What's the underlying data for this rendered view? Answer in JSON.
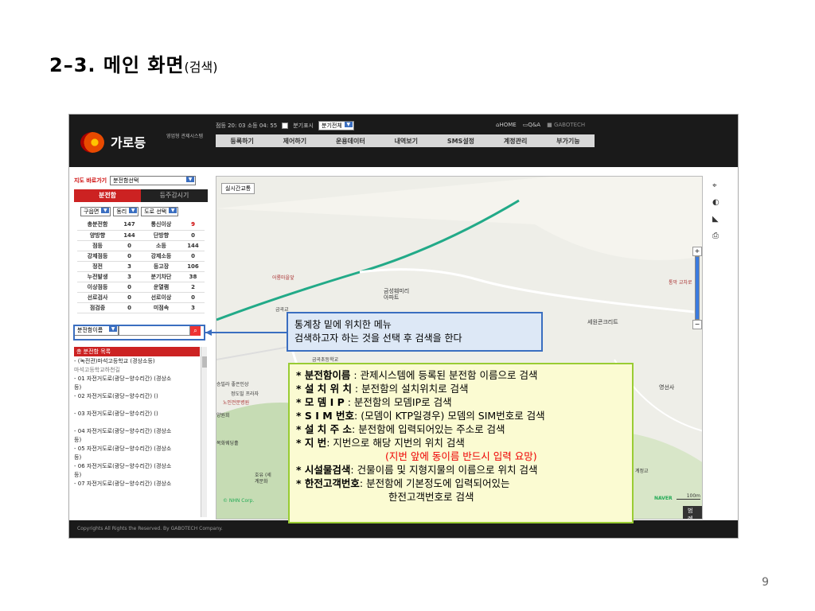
{
  "slide": {
    "title": "2–3. 메인 화면",
    "title_sub": "(검색)",
    "page_number": "9"
  },
  "app": {
    "logo_name": "가로등",
    "logo_tag": "영업형 관제시스템",
    "top_info": {
      "status_text": "점등 20: 03 소등 04: 55",
      "branch_label": "분기표시",
      "branch_select": "분기전체"
    },
    "top_links": {
      "home": "HOME",
      "qa": "Q&A",
      "company": "GABOTECH"
    },
    "nav": [
      "등록하기",
      "제어하기",
      "운용데이터",
      "내역보기",
      "SMS설정",
      "계정관리",
      "부가기능"
    ],
    "footer": "Copyrights All Rights the Reserved. By GABOTECH Company."
  },
  "left_panel": {
    "jump_label": "지도 바로가기",
    "jump_select": "분전함선택",
    "tabs": [
      "분전함",
      "등주감시기"
    ],
    "filters": [
      "구읍면",
      "동리",
      "도로 선택"
    ],
    "stats": [
      [
        "총분전함",
        "147",
        "통신이상",
        "9"
      ],
      [
        "양방향",
        "144",
        "단방향",
        "0"
      ],
      [
        "점등",
        "0",
        "소등",
        "144"
      ],
      [
        "강제점등",
        "0",
        "강제소등",
        "0"
      ],
      [
        "정전",
        "3",
        "등고장",
        "106"
      ],
      [
        "누전발생",
        "3",
        "분기차단",
        "38"
      ],
      [
        "이상점등",
        "0",
        "운열램",
        "2"
      ],
      [
        "선로검사",
        "0",
        "선로이상",
        "0"
      ],
      [
        "점검중",
        "0",
        "미점속",
        "3"
      ]
    ],
    "search_select": "분전함이름",
    "list_header": "총 분전함 목록",
    "list_items": [
      "- (녹전관)마석고등학교 (경상소등)",
      "마석고등학교하천길",
      "- 01 자전거도로(광당~양수리간) (경상소",
      "등)",
      "- 02 자전거도로(광당~양수리간) ()",
      "",
      "- 03 자전거도로(광당~양수리간) ()",
      "",
      "- 04 자전거도로(광당~양수리간) (경상소",
      "등)",
      "- 05 자전거도로(광당~양수리간) (경상소",
      "등)",
      "- 06 자전거도로(광당~양수리간) (경상소",
      "등)",
      "- 07 자전거도로(광당~양수리간) (경상소"
    ]
  },
  "map": {
    "realtime_btn": "실시간교통",
    "labels": {
      "seowon": "세원콘크리트",
      "yeongseonsa": "영선사",
      "eoryong": "어룡마을앞",
      "geumseong": "금성훼미리 아파트",
      "geumgok_school": "금곡초등학교",
      "geumgok_gyo": "금곡교",
      "tongmak": "통막 교차로",
      "gyejeong": "계정교",
      "jeongdo": "정도빌 프라자",
      "noinjeong": "노인전문병원",
      "yangwon": "양원회",
      "mokhwa": "목화웨딩홀",
      "hoyu": "호유 (세계문화",
      "sunggun": "승빌라 좋은인상"
    },
    "nhn": "© NHN Corp.",
    "naver": "NAVER",
    "scale": "100m",
    "legend": "범례"
  },
  "callout1": {
    "line1": "통계창 밑에 위치한 메뉴",
    "line2": "검색하고자 하는 것을 선택 후 검색을 한다"
  },
  "callout2": [
    {
      "key": "분전함이름",
      "sep": " : ",
      "text": "관제시스템에 등록된 분전함 이름으로 검색"
    },
    {
      "key": "설 치 위 치",
      "sep": " : ",
      "text": "분전함의 설치위치로 검색"
    },
    {
      "key": "모 뎀  I P",
      "sep": " : ",
      "text": "분전함의 모뎀IP로 검색"
    },
    {
      "key": "S I M 번호",
      "sep": ": ",
      "text": "(모뎀이 KTP일경우) 모뎀의 SIM번호로 검색"
    },
    {
      "key": "설 치 주 소",
      "sep": ": ",
      "text": "분전함에 입력되어있는 주소로 검색"
    },
    {
      "key": "지       번",
      "sep": ": ",
      "text": "지번으로 해당 지번의 위치 검색"
    },
    {
      "note": "(지번 앞에 동이름 반드시 입력 요망)"
    },
    {
      "key": "시설물검색",
      "sep": ": ",
      "text": "건물이름 및 지형지물의 이름으로 위치 검색"
    },
    {
      "key": "한전고객번호",
      "sep": ": ",
      "text": "분전함에 기본정도에 입력되어있는"
    },
    {
      "cont": "한전고객번호로 검색"
    }
  ]
}
